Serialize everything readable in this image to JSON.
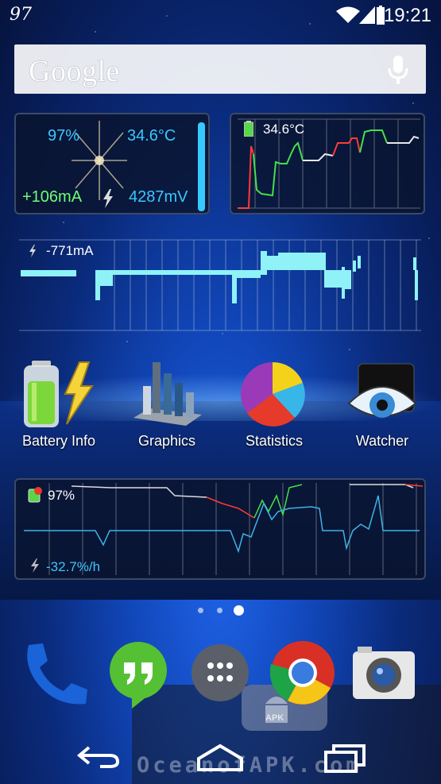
{
  "status_bar": {
    "left_indicator": "97",
    "time": "19:21",
    "icons": [
      "wifi-icon",
      "signal-icon",
      "battery-icon"
    ]
  },
  "search": {
    "brand": "Google",
    "icon": "mic-icon"
  },
  "battery_widget": {
    "percent": "97%",
    "temperature": "34.6°C",
    "current": "+106mA",
    "voltage": "4287mV",
    "colors": {
      "percent": "#3bc7ff",
      "current": "#6dff72",
      "bar": "#37c8ff"
    }
  },
  "temp_chart_widget": {
    "label": "34.6°C"
  },
  "current_chart_widget": {
    "label": "-771mA"
  },
  "apps": [
    {
      "label": "Battery Info",
      "icon": "battery-bolt-icon"
    },
    {
      "label": "Graphics",
      "icon": "bar-chart-3d-icon"
    },
    {
      "label": "Statistics",
      "icon": "pie-chart-icon"
    },
    {
      "label": "Watcher",
      "icon": "eye-icon"
    }
  ],
  "history_widget": {
    "percent": "97%",
    "rate": "-32.7%/h"
  },
  "page_indicator": {
    "pages": 3,
    "active": 3
  },
  "dock": [
    "phone-icon",
    "hangouts-icon",
    "app-drawer-icon",
    "chrome-icon",
    "camera-icon"
  ],
  "nav": [
    "back-icon",
    "home-icon",
    "recents-icon"
  ],
  "watermark": {
    "text": "OceanofAPK.com",
    "badge": "APK"
  }
}
